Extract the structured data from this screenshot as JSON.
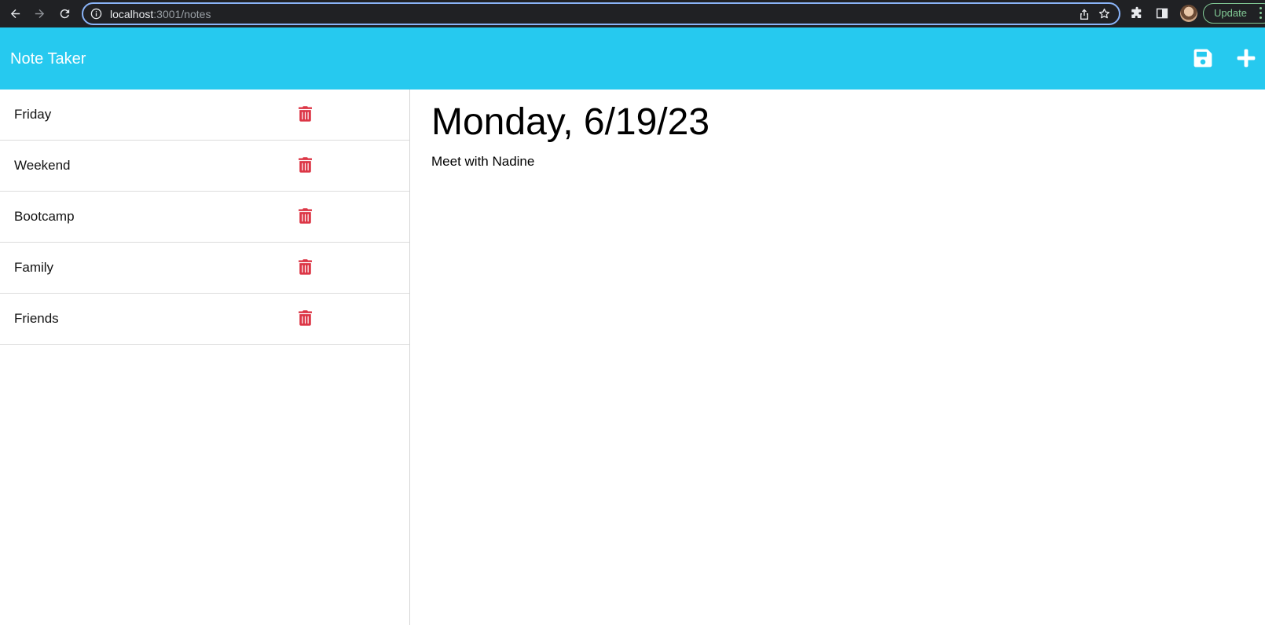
{
  "browser": {
    "url_host": "localhost",
    "url_rest": ":3001/notes",
    "update_label": "Update"
  },
  "app": {
    "title": "Note Taker",
    "accent_color": "#26c9ef",
    "delete_color": "#dc3545",
    "header_icons": [
      "save-icon",
      "plus-icon"
    ]
  },
  "notes": [
    {
      "title": "Friday"
    },
    {
      "title": "Weekend"
    },
    {
      "title": "Bootcamp"
    },
    {
      "title": "Family"
    },
    {
      "title": "Friends"
    }
  ],
  "active_note": {
    "title": "Monday, 6/19/23",
    "text": "Meet with Nadine"
  }
}
